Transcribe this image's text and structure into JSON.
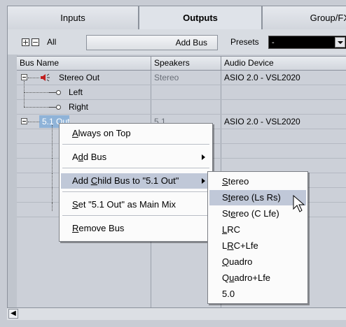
{
  "tabs": [
    {
      "label": "Inputs",
      "active": false
    },
    {
      "label": "Outputs",
      "active": true
    },
    {
      "label": "Group/FX",
      "active": false
    }
  ],
  "toolbar": {
    "expand_all_icon": "plus-box-icon",
    "collapse_all_icon": "minus-box-icon",
    "all_label": "All",
    "add_bus_label": "Add Bus",
    "presets_label": "Presets",
    "presets_value": "-"
  },
  "columns": [
    "Bus Name",
    "Speakers",
    "Audio Device"
  ],
  "rows": [
    {
      "name": "Stereo Out",
      "speakers": "Stereo",
      "device": "ASIO 2.0 - VSL2020",
      "icon": "speaker-icon"
    },
    {
      "name": "Left",
      "speakers": "",
      "device": ""
    },
    {
      "name": "Right",
      "speakers": "",
      "device": ""
    },
    {
      "name": "5.1 Out",
      "speakers": "5.1",
      "device": "ASIO 2.0 - VSL2020"
    }
  ],
  "context_menu": {
    "items": [
      {
        "label": "Always on Top",
        "mnemonic": "A",
        "rest": "lways on Top",
        "submenu": false
      },
      {
        "label": "Add Bus",
        "pre": "A",
        "mnemonic": "d",
        "rest": "d Bus",
        "submenu": true
      },
      {
        "label": "Add Child Bus to \"5.1 Out\"",
        "pre": "Add ",
        "mnemonic": "C",
        "rest": "hild Bus to \"5.1 Out\"",
        "submenu": true,
        "highlighted": true
      },
      {
        "label": "Set \"5.1 Out\" as Main Mix",
        "mnemonic": "S",
        "rest": "et \"5.1 Out\" as Main Mix",
        "submenu": false
      },
      {
        "label": "Remove Bus",
        "mnemonic": "R",
        "rest": "emove Bus",
        "submenu": false
      }
    ]
  },
  "submenu": {
    "items": [
      {
        "label": "Stereo",
        "pre": "",
        "mnemonic": "S",
        "rest": "tereo"
      },
      {
        "label": "Stereo (Ls Rs)",
        "pre": "S",
        "mnemonic": "t",
        "rest": "ereo (Ls Rs)",
        "highlighted": true
      },
      {
        "label": "Stereo (C Lfe)",
        "pre": "St",
        "mnemonic": "e",
        "rest": "reo (C Lfe)"
      },
      {
        "label": "LRC",
        "pre": "",
        "mnemonic": "L",
        "rest": "RC"
      },
      {
        "label": "LRC+Lfe",
        "pre": "L",
        "mnemonic": "R",
        "rest": "C+Lfe"
      },
      {
        "label": "Quadro",
        "pre": "",
        "mnemonic": "Q",
        "rest": "uadro"
      },
      {
        "label": "Quadro+Lfe",
        "pre": "Q",
        "mnemonic": "u",
        "rest": "adro+Lfe"
      },
      {
        "label": "5.0",
        "pre": "",
        "mnemonic": "",
        "rest": "5.0"
      }
    ]
  },
  "scroll_left_icon": "arrow-left-icon"
}
